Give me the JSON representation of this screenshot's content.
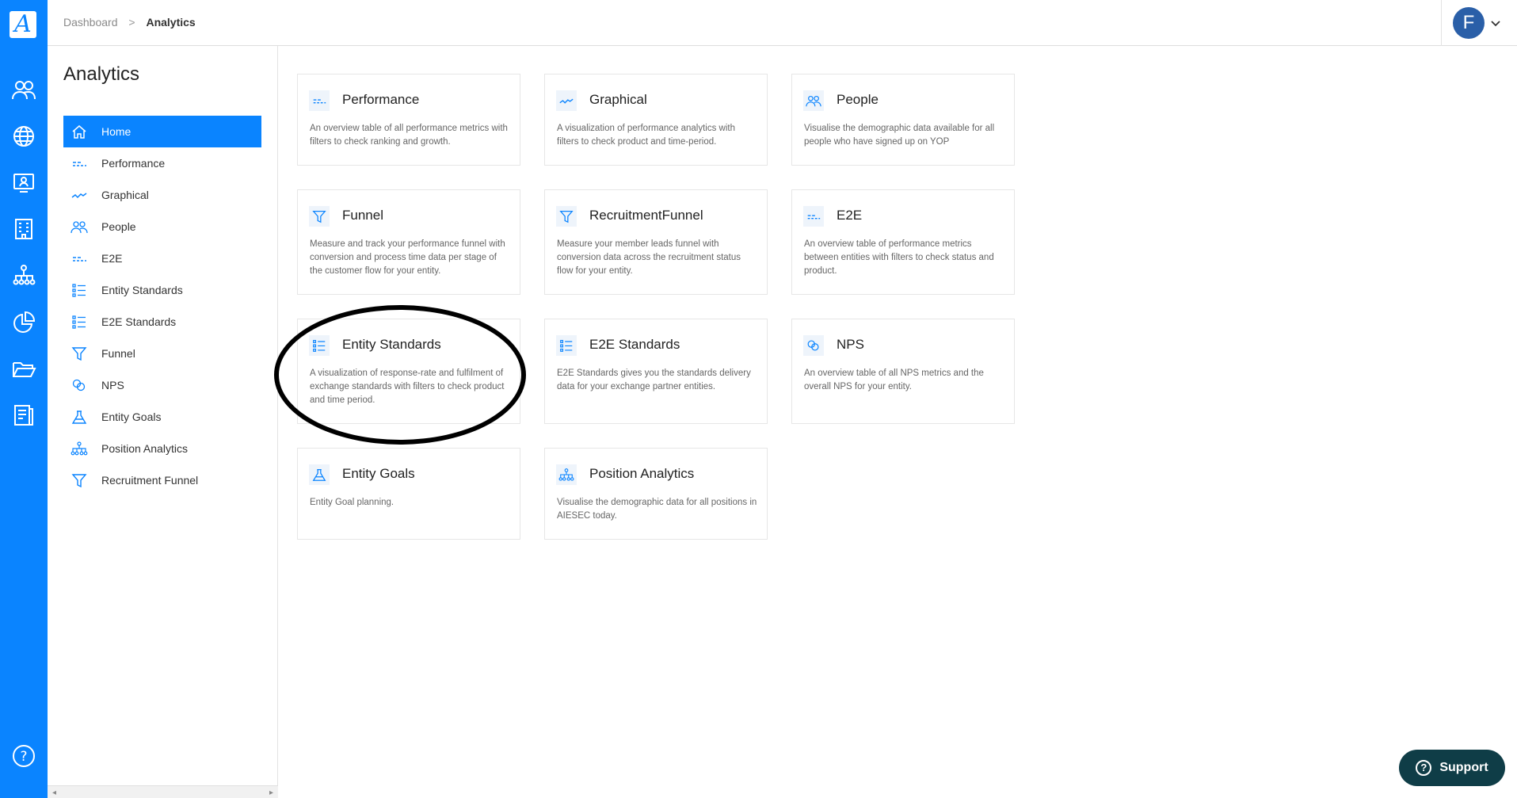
{
  "breadcrumb": {
    "root": "Dashboard",
    "separator": ">",
    "current": "Analytics"
  },
  "user": {
    "initial": "F"
  },
  "logo": {
    "letter": "A"
  },
  "sidebar": {
    "title": "Analytics",
    "items": [
      {
        "label": "Home",
        "icon": "home-icon",
        "active": true
      },
      {
        "label": "Performance",
        "icon": "table-icon"
      },
      {
        "label": "Graphical",
        "icon": "line-chart-icon"
      },
      {
        "label": "People",
        "icon": "people-icon"
      },
      {
        "label": "E2E",
        "icon": "table-icon"
      },
      {
        "label": "Entity Standards",
        "icon": "list-icon"
      },
      {
        "label": "E2E Standards",
        "icon": "list-icon"
      },
      {
        "label": "Funnel",
        "icon": "funnel-icon"
      },
      {
        "label": "NPS",
        "icon": "circles-icon"
      },
      {
        "label": "Entity Goals",
        "icon": "flask-icon"
      },
      {
        "label": "Position Analytics",
        "icon": "org-chart-icon"
      },
      {
        "label": "Recruitment Funnel",
        "icon": "funnel-icon"
      }
    ]
  },
  "cards": [
    {
      "title": "Performance",
      "icon": "table-icon",
      "description": "An overview table of all performance metrics with filters to check ranking and growth."
    },
    {
      "title": "Graphical",
      "icon": "line-chart-icon",
      "description": "A visualization of performance analytics with filters to check product and time-period."
    },
    {
      "title": "People",
      "icon": "people-icon",
      "description": "Visualise the demographic data available for all people who have signed up on YOP"
    },
    {
      "title": "Funnel",
      "icon": "funnel-icon",
      "description": "Measure and track your performance funnel with conversion and process time data per stage of the customer flow for your entity."
    },
    {
      "title": "RecruitmentFunnel",
      "icon": "funnel-icon",
      "description": "Measure your member leads funnel with conversion data across the recruitment status flow for your entity."
    },
    {
      "title": "E2E",
      "icon": "table-icon",
      "description": "An overview table of performance metrics between entities with filters to check status and product."
    },
    {
      "title": "Entity Standards",
      "icon": "list-icon",
      "description": "A visualization of response-rate and fulfilment of exchange standards with filters to check product and time period."
    },
    {
      "title": "E2E Standards",
      "icon": "list-icon",
      "description": "E2E Standards gives you the standards delivery data for your exchange partner entities."
    },
    {
      "title": "NPS",
      "icon": "circles-icon",
      "description": "An overview table of all NPS metrics and the overall NPS for your entity."
    },
    {
      "title": "Entity Goals",
      "icon": "flask-icon",
      "description": "Entity Goal planning."
    },
    {
      "title": "Position Analytics",
      "icon": "org-chart-icon",
      "description": "Visualise the demographic data for all positions in AIESEC today."
    }
  ],
  "support": {
    "label": "Support",
    "help_glyph": "?"
  },
  "rail_help": "?",
  "colors": {
    "primary": "#0a84ff",
    "support_bg": "#0f3d47",
    "avatar": "#2a5fa8"
  }
}
